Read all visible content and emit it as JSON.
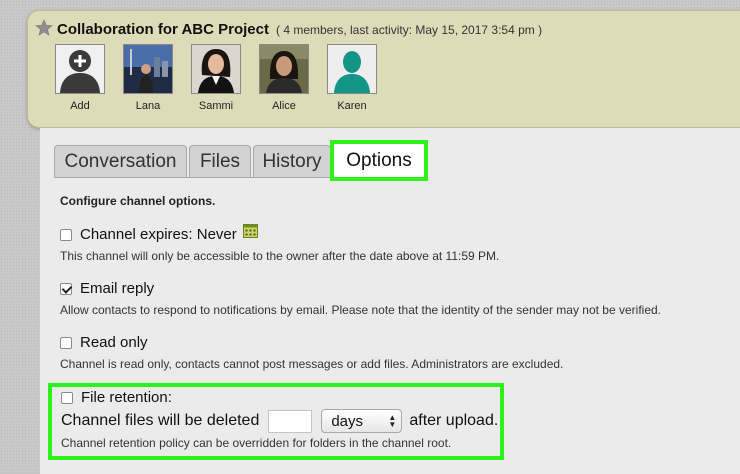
{
  "channel": {
    "title": "Collaboration for ABC Project",
    "meta": "( 4 members, last activity: May 15, 2017 3:54 pm )"
  },
  "members": [
    {
      "label": "Add",
      "icon": "add-member-icon"
    },
    {
      "label": "Lana",
      "icon": "photo"
    },
    {
      "label": "Sammi",
      "icon": "photo"
    },
    {
      "label": "Alice",
      "icon": "photo"
    },
    {
      "label": "Karen",
      "icon": "default-avatar-icon"
    }
  ],
  "tabs": [
    {
      "label": "Conversation"
    },
    {
      "label": "Files"
    },
    {
      "label": "History"
    },
    {
      "label": "Options",
      "active": true
    }
  ],
  "options": {
    "section_title": "Configure channel options.",
    "expires": {
      "label": "Channel expires: Never",
      "checked": false,
      "desc": "This channel will only be accessible to the owner after the date above at 11:59 PM."
    },
    "email_reply": {
      "label": "Email reply",
      "checked": true,
      "desc": "Allow contacts to respond to notifications by email. Please note that the identity of the sender may not be verified."
    },
    "read_only": {
      "label": "Read only",
      "checked": false,
      "desc": "Channel is read only, contacts cannot post messages or add files. Administrators are excluded."
    },
    "file_retention": {
      "label": "File retention:",
      "checked": false,
      "prefix": "Channel files will be deleted",
      "value": "",
      "unit": "days",
      "suffix": "after upload.",
      "desc": "Channel retention policy can be overridden for folders in the channel root."
    }
  },
  "colors": {
    "highlight": "#2ef21a",
    "header_bg": "#dedcb8",
    "panel_bg": "#ebebeb"
  }
}
